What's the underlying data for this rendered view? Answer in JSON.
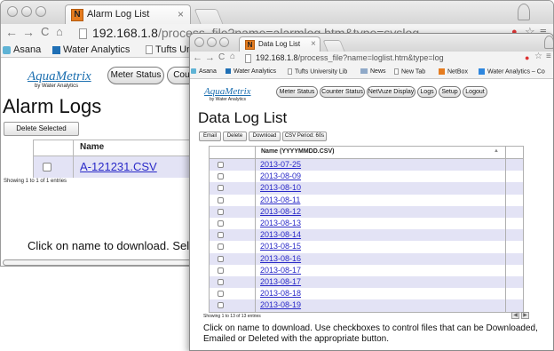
{
  "back_window": {
    "tab_title": "Alarm Log List",
    "tab_close": "×",
    "favicon_letter": "N",
    "url_host": "192.168.1.8",
    "url_path": "/process_file?name=alarmlog.htm&type=syslog",
    "bookmarks": [
      "Asana",
      "Water Analytics",
      "Tufts University Lib"
    ],
    "logo_text": "AquaMetrix",
    "logo_sub": "by Water Analytics",
    "nav_buttons": [
      "Meter Status",
      "Counter"
    ],
    "heading": "Alarm Logs",
    "delete_button": "Delete Selected",
    "table_header": "Name",
    "rows": [
      "A-121231.CSV"
    ],
    "showing": "Showing 1 to 1 of 1 entries",
    "footer_msg": "Click on name to download. Select fi"
  },
  "front_window": {
    "tab_title": "Data Log List",
    "tab_close": "×",
    "favicon_letter": "N",
    "url_host": "192.168.1.8",
    "url_path": "/process_file?name=loglist.htm&type=log",
    "bookmarks": [
      "Asana",
      "Water Analytics",
      "Tufts University Lib",
      "News",
      "New Tab",
      "NetBox",
      "Water Analytics – Co"
    ],
    "logo_text": "AquaMetrix",
    "logo_sub": "by Water Analytics",
    "nav_buttons": [
      "Meter Status",
      "Counter Status",
      "NetVuze Display",
      "Logs",
      "Setup",
      "Logout"
    ],
    "heading": "Data Log List",
    "toolbar": [
      "Email",
      "Delete",
      "Download",
      "CSV Period: 60s"
    ],
    "table_header": "Name (YYYYMMDD.CSV)",
    "sort_glyph": "▲",
    "rows": [
      "2013-07-25",
      "2013-08-09",
      "2013-08-10",
      "2013-08-11",
      "2013-08-12",
      "2013-08-13",
      "2013-08-14",
      "2013-08-15",
      "2013-08-16",
      "2013-08-17",
      "2013-08-17",
      "2013-08-18",
      "2013-08-19"
    ],
    "showing": "Showing 1 to 13 of 13 entries",
    "footer_msg": "Click on name to download. Use checkboxes to control files that can be Downloaded, Emailed or Deleted with the appropriate button."
  },
  "colors": {
    "row_odd": "#e3e3f5",
    "row_even": "#ffffff",
    "link": "#2a2ac8",
    "logo": "#1c6fb0",
    "favicon": "#e57c1f"
  }
}
